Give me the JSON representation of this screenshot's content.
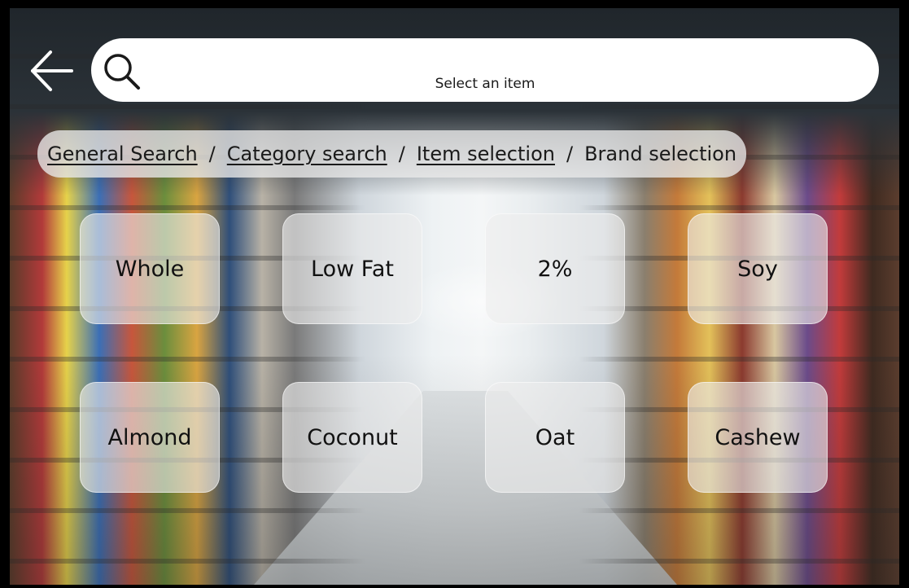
{
  "search": {
    "placeholder": "Select an item",
    "icon": "search-icon"
  },
  "nav": {
    "back_icon": "arrow-left-icon"
  },
  "breadcrumb": {
    "items": [
      "General Search",
      "Category search",
      "Item selection",
      "Brand selection"
    ],
    "separator": "/"
  },
  "options": [
    "Whole",
    "Low Fat",
    "2%",
    "Soy",
    "Almond",
    "Coconut",
    "Oat",
    "Cashew"
  ],
  "background": {
    "description_color_accent": "#ffffff"
  }
}
